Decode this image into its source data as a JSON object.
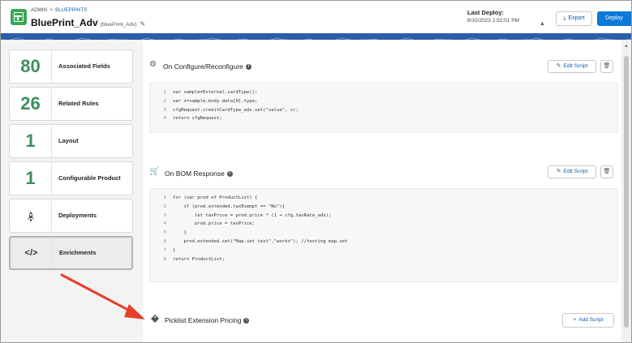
{
  "header": {
    "breadcrumb": {
      "root": "ADMIN",
      "separator": ">",
      "current": "BLUEPRINTS"
    },
    "title": "BluePrint_Adv",
    "subtitle": "(bluePrint_Adv)",
    "last_deploy_label": "Last Deploy:",
    "last_deploy_date": "8/10/2023 2:52:01 PM",
    "export_label": "Export",
    "deploy_label": "Deploy",
    "icons": {
      "app": "blueprint-app-icon",
      "edit": "pencil-icon",
      "export": "download-icon",
      "developer": "developer-icon"
    }
  },
  "sidebar": {
    "items": [
      {
        "value": "80",
        "label": "Associated Fields"
      },
      {
        "value": "26",
        "label": "Related Rules"
      },
      {
        "value": "1",
        "label": "Layout"
      },
      {
        "value": "1",
        "label": "Configurable Product"
      },
      {
        "icon": "rocket-icon",
        "label": "Deployments"
      },
      {
        "icon": "code-icon",
        "glyph": "</>",
        "label": "Enrichments",
        "active": true
      }
    ]
  },
  "sections": [
    {
      "title": "On Configure/Reconfigure",
      "icon": "gear-icon",
      "edit_label": "Edit Script",
      "code": [
        "var sample=External.cardType();",
        "var x=sample.body.data[0].type;",
        "cfgRequest.creditCardType_adv.set(\"value\", x);",
        "return cfgRequest;"
      ]
    },
    {
      "title": "On BOM Response",
      "icon": "cart-icon",
      "edit_label": "Edit Script",
      "code": [
        "for (var prod of ProductList) {",
        "    if (prod.extended.taxExempt == \"No\"){",
        "        let taxPrice = prod.price * (1 + cfg.taxRate_adv);",
        "        prod.price = taxPrice;",
        "    }",
        "    prod.extended.set(\"Map.set test\",\"works\"); //testing map.set",
        "}",
        "return ProductList;"
      ]
    },
    {
      "title": "Picklist Extension Pricing",
      "icon": "tag-icon",
      "add_label": "Add Script"
    }
  ],
  "colors": {
    "accent": "#0b7ad8",
    "band": "#2c5da8",
    "count": "#3d8f5e",
    "annotation": "#e53f2a"
  }
}
